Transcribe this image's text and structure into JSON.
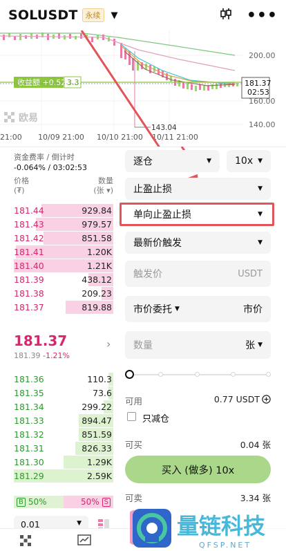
{
  "header": {
    "pair": "SOLUSDT",
    "tag": "永续",
    "candle_icon": "candlestick-icon",
    "more_icon": "more-icon"
  },
  "chart": {
    "price_ticks": [
      "200.00",
      "181.37",
      "160.00",
      "140.00"
    ],
    "countdown": "02:53",
    "date_ticks": [
      "21:00",
      "10/09 21:00",
      "10/10 21:00",
      "10/11 21:00"
    ],
    "low_label": "143.04",
    "pnl_label": "收益额 +0.52",
    "pnl_value": "3.3",
    "watermark": "欧易",
    "line_colors": {
      "ma_green": "#7fc87f",
      "ma_pink": "#e29fc0",
      "ma_teal": "#3fc7c7",
      "ma_gold": "#d6a24a",
      "ma_brown": "#9a6a57",
      "pnl_line": "#8cc63f"
    }
  },
  "funding": {
    "label": "资金费率 / 倒计时",
    "value": "-0.064% / 03:02:53"
  },
  "orderbook": {
    "price_label": "价格",
    "price_unit": "(₮)",
    "qty_label": "数量",
    "qty_unit": "(张 ▾)",
    "asks": [
      {
        "price": "181.44",
        "qty": "929.84",
        "depth": 0.72
      },
      {
        "price": "181.43",
        "qty": "979.57",
        "depth": 0.78
      },
      {
        "price": "181.42",
        "qty": "851.58",
        "depth": 0.7
      },
      {
        "price": "181.41",
        "qty": "1.20K",
        "depth": 0.98
      },
      {
        "price": "181.40",
        "qty": "1.21K",
        "depth": 1.0
      },
      {
        "price": "181.39",
        "qty": "438.12",
        "depth": 0.25
      },
      {
        "price": "181.38",
        "qty": "209.23",
        "depth": 0.12
      },
      {
        "price": "181.37",
        "qty": "819.88",
        "depth": 0.48
      }
    ],
    "last_price": "181.37",
    "mark_price": "181.39",
    "change": "-1.21%",
    "bids": [
      {
        "price": "181.36",
        "qty": "110.3",
        "depth": 0.05
      },
      {
        "price": "181.35",
        "qty": "73.6",
        "depth": 0.05
      },
      {
        "price": "181.34",
        "qty": "299.22",
        "depth": 0.1
      },
      {
        "price": "181.33",
        "qty": "894.47",
        "depth": 0.35
      },
      {
        "price": "181.32",
        "qty": "851.59",
        "depth": 0.35
      },
      {
        "price": "181.31",
        "qty": "826.33",
        "depth": 0.38
      },
      {
        "price": "181.30",
        "qty": "1.29K",
        "depth": 0.5
      },
      {
        "price": "181.29",
        "qty": "2.59K",
        "depth": 1.0
      }
    ],
    "buy_box": "B",
    "buy_ratio": "50%",
    "sell_ratio": "50%",
    "sell_box": "S",
    "precision": "0.01"
  },
  "form": {
    "margin_mode": "逐仓",
    "leverage": "10x",
    "order_type": "止盈止损",
    "tpsl_type": "单向止盈止损",
    "trigger_type": "最新价触发",
    "trigger_placeholder": "触发价",
    "trigger_unit": "USDT",
    "exec_type": "市价委托",
    "exec_value": "市价",
    "qty_placeholder": "数量",
    "qty_unit": "张",
    "available_label": "可用",
    "available_value": "0.77 USDT",
    "reduce_only": "只减仓",
    "can_buy_label": "可买",
    "can_buy_value": "0.04 张",
    "buy_button": "买入 (做多) 10x",
    "can_sell_label": "可卖",
    "can_sell_value": "3.34 张"
  },
  "watermark": {
    "cn": "量链科技",
    "en": "QFSP.NET"
  }
}
